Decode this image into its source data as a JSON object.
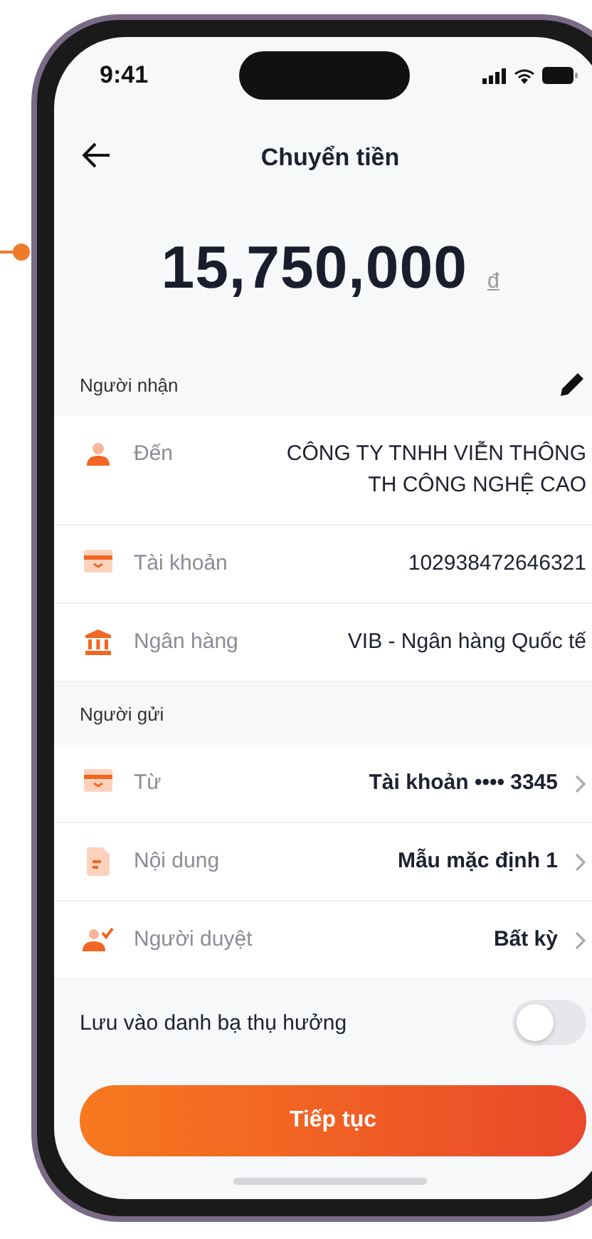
{
  "status_bar": {
    "time": "9:41"
  },
  "header": {
    "title": "Chuyển tiền"
  },
  "amount": {
    "value": "15,750,000",
    "currency": "đ"
  },
  "recipient": {
    "title": "Người nhận",
    "rows": [
      {
        "label": "Đến",
        "value": "CÔNG TY TNHH VIỄN THÔNG TH CÔNG NGHỆ CAO",
        "chevron": false
      },
      {
        "label": "Tài khoản",
        "value": "102938472646321",
        "chevron": false
      },
      {
        "label": "Ngân hàng",
        "value": "VIB - Ngân hàng Quốc tế",
        "chevron": false
      }
    ]
  },
  "sender": {
    "title": "Người gửi",
    "rows": [
      {
        "label": "Từ",
        "value": "Tài khoản •••• 3345",
        "chevron": true
      },
      {
        "label": "Nội dung",
        "value": "Mẫu mặc định 1",
        "chevron": true
      },
      {
        "label": "Người duyệt",
        "value": "Bất kỳ",
        "chevron": true
      }
    ]
  },
  "save_contact": {
    "label": "Lưu vào danh bạ thụ hưởng",
    "on": false
  },
  "continue_button": {
    "label": "Tiếp tục"
  }
}
